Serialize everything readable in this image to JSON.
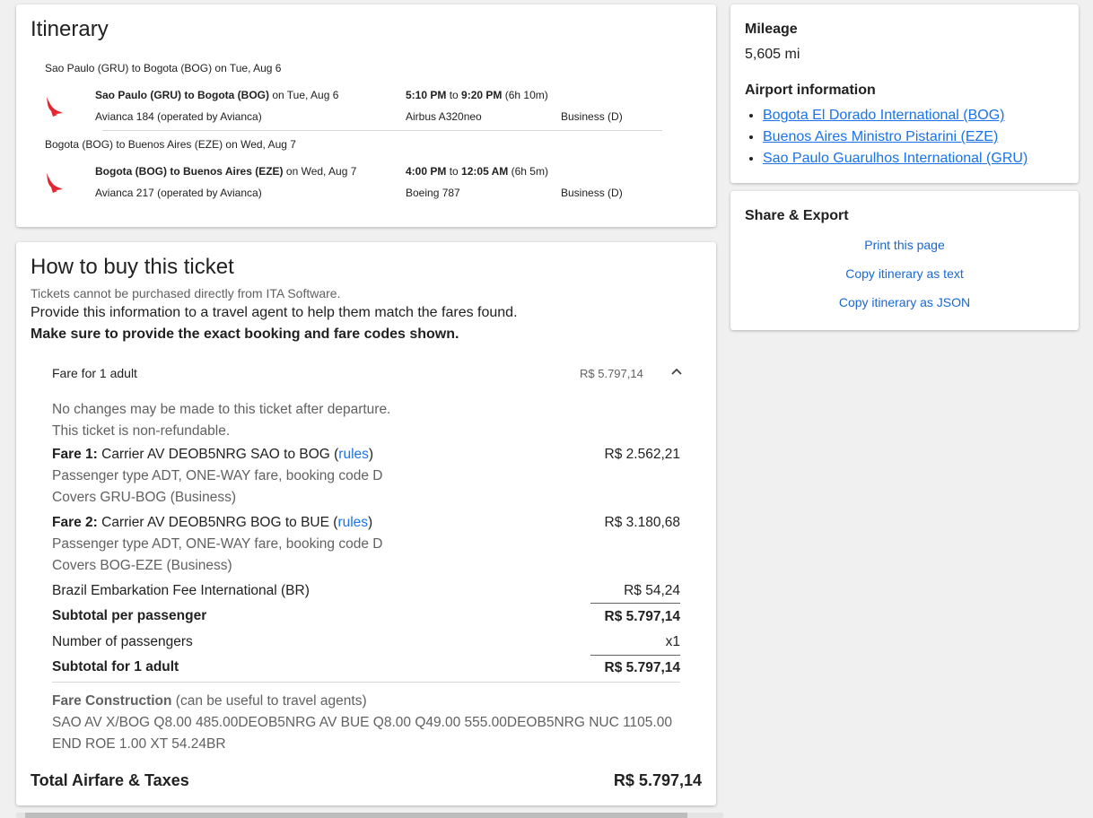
{
  "itinerary": {
    "title": "Itinerary",
    "segments": [
      {
        "header": "Sao Paulo (GRU) to Bogota (BOG) on Tue, Aug 6",
        "route_bold": "Sao Paulo (GRU) to Bogota (BOG)",
        "route_rest": " on Tue, Aug 6",
        "dep_time": "5:10 PM",
        "to": " to ",
        "arr_time": "9:20 PM",
        "duration": " (6h 10m)",
        "flight": "Avianca 184 (operated by Avianca)",
        "aircraft": "Airbus A320neo",
        "cabin": "Business (D)"
      },
      {
        "header": "Bogota (BOG) to Buenos Aires (EZE) on Wed, Aug 7",
        "route_bold": "Bogota (BOG) to Buenos Aires (EZE)",
        "route_rest": " on Wed, Aug 7",
        "dep_time": "4:00 PM",
        "to": " to ",
        "arr_time": "12:05 AM",
        "duration": " (6h 5m)",
        "flight": "Avianca 217 (operated by Avianca)",
        "aircraft": "Boeing 787",
        "cabin": "Business (D)"
      }
    ],
    "airline_icon": "avianca-logo-icon",
    "airline_color": "#e3262f"
  },
  "buy": {
    "title": "How to buy this ticket",
    "note": "Tickets cannot be purchased directly from ITA Software.",
    "instruction": "Provide this information to a travel agent to help them match the fares found.",
    "emphasis": "Make sure to provide the exact booking and fare codes shown.",
    "fare_header_label": "Fare for 1 adult",
    "fare_header_price": "R$ 5.797,14",
    "toggle_icon": "chevron-up-icon",
    "restriction1": "No changes may be made to this ticket after departure.",
    "restriction2": "This ticket is non-refundable.",
    "fares": [
      {
        "label": "Fare 1:",
        "desc": " Carrier AV DEOB5NRG SAO to BOG (",
        "rules": "rules",
        "close": ")",
        "price": "R$ 2.562,21",
        "line2": "Passenger type ADT, ONE-WAY fare, booking code D",
        "line3": "Covers GRU-BOG (Business)"
      },
      {
        "label": "Fare 2:",
        "desc": " Carrier AV DEOB5NRG BOG to BUE (",
        "rules": "rules",
        "close": ")",
        "price": "R$ 3.180,68",
        "line2": "Passenger type ADT, ONE-WAY fare, booking code D",
        "line3": "Covers BOG-EZE (Business)"
      }
    ],
    "tax_label": "Brazil Embarkation Fee International (BR)",
    "tax_price": "R$ 54,24",
    "subtotal_pp_label": "Subtotal per passenger",
    "subtotal_pp_price": "R$ 5.797,14",
    "passengers_label": "Number of passengers",
    "passengers_value": "x1",
    "subtotal_label": "Subtotal for 1 adult",
    "subtotal_price": "R$ 5.797,14",
    "fc_label": "Fare Construction",
    "fc_hint": " (can be useful to travel agents)",
    "fc_line1": "SAO AV X/BOG Q8.00 485.00DEOB5NRG AV BUE Q8.00 Q49.00 555.00DEOB5NRG NUC 1105.00",
    "fc_line2": "END ROE 1.00 XT 54.24BR",
    "total_label": "Total Airfare & Taxes",
    "total_price": "R$ 5.797,14"
  },
  "sidebar": {
    "mileage_title": "Mileage",
    "mileage_value": "5,605 mi",
    "airport_title": "Airport information",
    "airports": [
      "Bogota El Dorado International (BOG)",
      "Buenos Aires Ministro Pistarini (EZE)",
      "Sao Paulo Guarulhos International (GRU)"
    ],
    "share_title": "Share & Export",
    "share_links": [
      "Print this page",
      "Copy itinerary as text",
      "Copy itinerary as JSON"
    ]
  }
}
